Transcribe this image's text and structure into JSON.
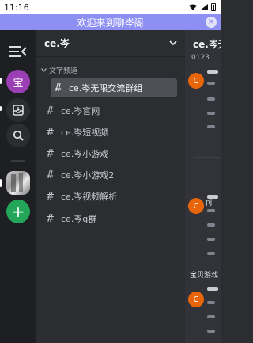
{
  "statusbar": {
    "time": "11:16"
  },
  "banner": {
    "text": "欢迎来到聊岑阁",
    "close_glyph": "×"
  },
  "rail": {
    "avatar_text": "宝",
    "add_glyph": "+"
  },
  "server": {
    "name": "ce.岑",
    "category": "文字频道",
    "channels": [
      {
        "label": "ce.岑无限交流群组",
        "active": true
      },
      {
        "label": "ce.岑官网"
      },
      {
        "label": "ce.岑短视频"
      },
      {
        "label": "ce.岑小游戏"
      },
      {
        "label": "ce.岑小游戏2"
      },
      {
        "label": "ce.岑视频解析"
      },
      {
        "label": "ce.岑q群"
      }
    ]
  },
  "chat": {
    "title": "ce.岑无",
    "top_snippet": "0123",
    "avatar_letter": "C",
    "label_pj": "pj",
    "label_baobei": "宝贝游戏"
  },
  "colors": {
    "banner": "#8e8ff2",
    "avatar_purple": "#9b3fb5",
    "add_green": "#23a55a",
    "avatar_orange": "#e8650a"
  }
}
